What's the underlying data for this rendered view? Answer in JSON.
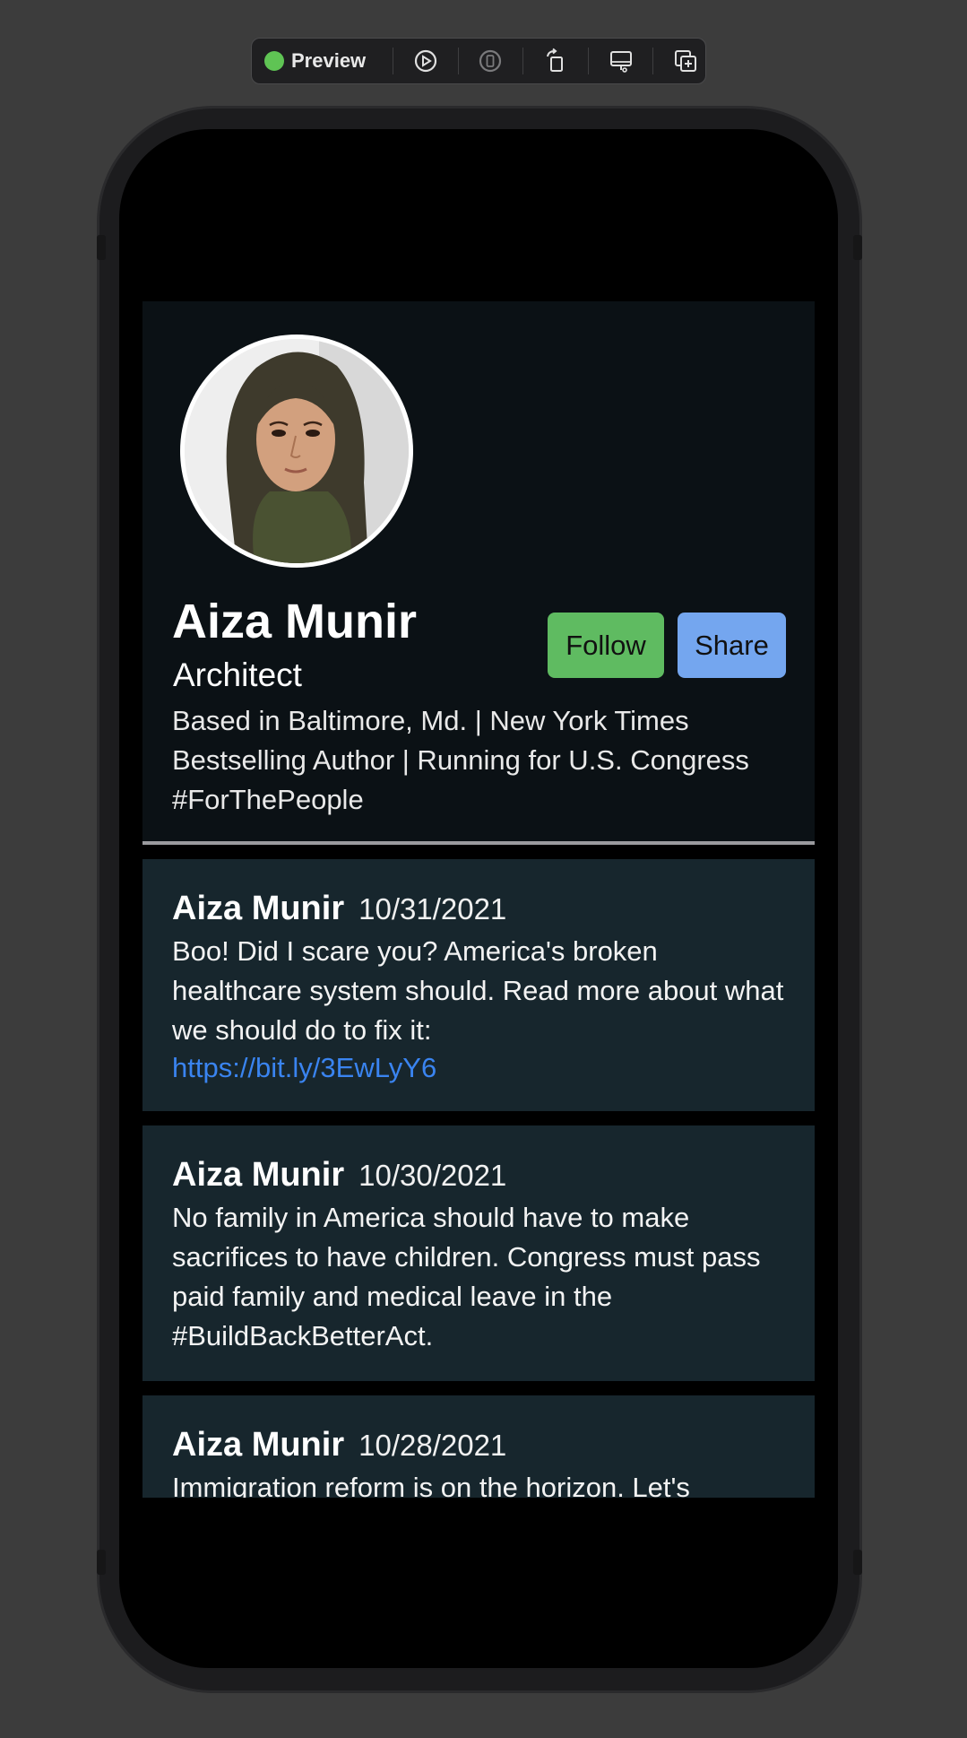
{
  "toolbar": {
    "preview_label": "Preview",
    "icons": [
      "play-icon",
      "device-icon",
      "rotate-icon",
      "display-settings-icon",
      "duplicate-icon"
    ],
    "status_color": "#5fc454"
  },
  "profile": {
    "name": "Aiza Munir",
    "role": "Architect",
    "bio": "Based in Baltimore, Md. | New York Times Bestselling Author | Running for U.S. Congress #ForThePeople",
    "follow_label": "Follow",
    "share_label": "Share",
    "follow_color": "#5fbb61",
    "share_color": "#74a6ef"
  },
  "posts": [
    {
      "author": "Aiza Munir",
      "date": "10/31/2021",
      "body": "Boo! Did I scare you? America's broken healthcare system should. Read more about what we should do to fix it:",
      "link": "https://bit.ly/3EwLyY6"
    },
    {
      "author": "Aiza Munir",
      "date": "10/30/2021",
      "body": "No family in America should have to make sacrifices to have children. Congress must pass paid family and medical leave in the #BuildBackBetterAct."
    },
    {
      "author": "Aiza Munir",
      "date": "10/28/2021",
      "body": "Immigration reform is on the horizon. Let's"
    }
  ]
}
